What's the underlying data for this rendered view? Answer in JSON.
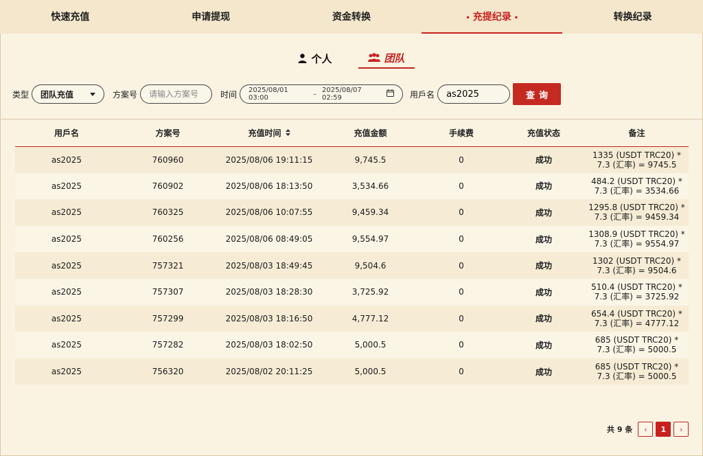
{
  "top_tabs": [
    {
      "label": "快速充值"
    },
    {
      "label": "申请提现"
    },
    {
      "label": "资金转换"
    },
    {
      "label": "充提纪录",
      "active": true
    },
    {
      "label": "转换纪录"
    }
  ],
  "sub_tabs": {
    "personal": "个人",
    "team": "团队"
  },
  "filter": {
    "type_label": "类型",
    "type_value": "团队充值",
    "plan_label": "方案号",
    "plan_placeholder": "请输入方案号",
    "time_label": "时间",
    "date_start": "2025/08/01 03:00",
    "date_sep": "–",
    "date_end": "2025/08/07 02:59",
    "user_label": "用戶名",
    "user_value": "as2025",
    "query_label": "查询"
  },
  "table": {
    "headers": [
      "用戶名",
      "方案号",
      "充值时间",
      "充值金额",
      "手续费",
      "充值状态",
      "备注"
    ],
    "rows": [
      [
        "as2025",
        "760960",
        "2025/08/06 19:11:15",
        "9,745.5",
        "0",
        "成功",
        "1335 (USDT TRC20) * 7.3 (汇率) = 9745.5"
      ],
      [
        "as2025",
        "760902",
        "2025/08/06 18:13:50",
        "3,534.66",
        "0",
        "成功",
        "484.2 (USDT TRC20) * 7.3 (汇率) = 3534.66"
      ],
      [
        "as2025",
        "760325",
        "2025/08/06 10:07:55",
        "9,459.34",
        "0",
        "成功",
        "1295.8 (USDT TRC20) * 7.3 (汇率) = 9459.34"
      ],
      [
        "as2025",
        "760256",
        "2025/08/06 08:49:05",
        "9,554.97",
        "0",
        "成功",
        "1308.9 (USDT TRC20) * 7.3 (汇率) = 9554.97"
      ],
      [
        "as2025",
        "757321",
        "2025/08/03 18:49:45",
        "9,504.6",
        "0",
        "成功",
        "1302 (USDT TRC20) * 7.3 (汇率) = 9504.6"
      ],
      [
        "as2025",
        "757307",
        "2025/08/03 18:28:30",
        "3,725.92",
        "0",
        "成功",
        "510.4 (USDT TRC20) * 7.3 (汇率) = 3725.92"
      ],
      [
        "as2025",
        "757299",
        "2025/08/03 18:16:50",
        "4,777.12",
        "0",
        "成功",
        "654.4 (USDT TRC20) * 7.3 (汇率) = 4777.12"
      ],
      [
        "as2025",
        "757282",
        "2025/08/03 18:02:50",
        "5,000.5",
        "0",
        "成功",
        "685 (USDT TRC20) * 7.3 (汇率) = 5000.5"
      ],
      [
        "as2025",
        "756320",
        "2025/08/02 20:11:25",
        "5,000.5",
        "0",
        "成功",
        "685 (USDT TRC20) * 7.3 (汇率) = 5000.5"
      ]
    ]
  },
  "pager": {
    "total": "共 9 条",
    "current": "1",
    "prev": "‹",
    "next": "›"
  },
  "colors": {
    "accent": "#c8201f",
    "background": "#faf3e2",
    "tab_bar": "#f4e7cc"
  },
  "icons": {
    "personal": "user-icon",
    "team": "group-icon",
    "date": "calendar-icon",
    "sort": "sort-icon"
  }
}
